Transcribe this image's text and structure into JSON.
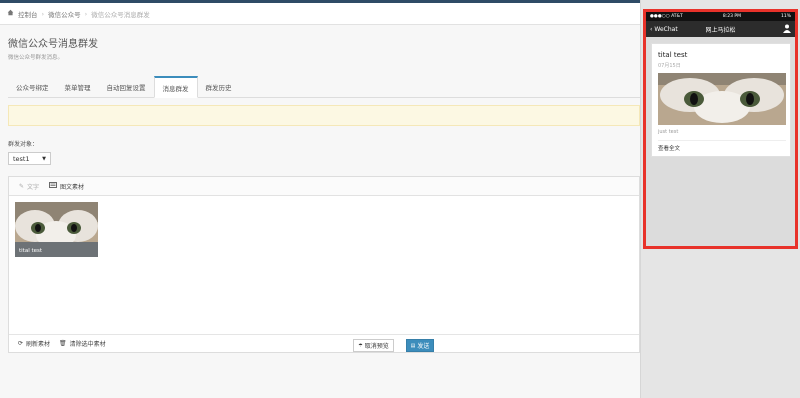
{
  "breadcrumb": {
    "home": "控制台",
    "level2": "微信公众号",
    "current": "微信公众号消息群发"
  },
  "page": {
    "title": "微信公众号消息群发",
    "subtitle": "微信公众号群发消息。"
  },
  "tabs": [
    {
      "label": "公众号绑定"
    },
    {
      "label": "菜单管理"
    },
    {
      "label": "自动回复设置"
    },
    {
      "label": "消息群发",
      "active": true
    },
    {
      "label": "群发历史"
    }
  ],
  "form": {
    "target_label": "群发对象：",
    "target_value": "test1"
  },
  "editor": {
    "text_label": "文字",
    "news_label": "图文素材",
    "selected_item_caption": "tital test",
    "refresh_label": "刷新素材",
    "clear_label": "清除选中素材"
  },
  "actions": {
    "cancel_preview": "取消预览",
    "send": "发送"
  },
  "phone": {
    "status_carrier": "●●●○○ AT&T",
    "status_time": "8:23 PM",
    "status_battery": "11%",
    "back_label": "WeChat",
    "account_name": "网上马拉松",
    "card": {
      "title": "tital test",
      "date": "07月15日",
      "digest": "just test",
      "read_more": "查看全文"
    }
  },
  "colors": {
    "accent": "#3c8dbc",
    "highlight_frame": "#e8322a",
    "alert_bg": "#fcf8e3"
  }
}
